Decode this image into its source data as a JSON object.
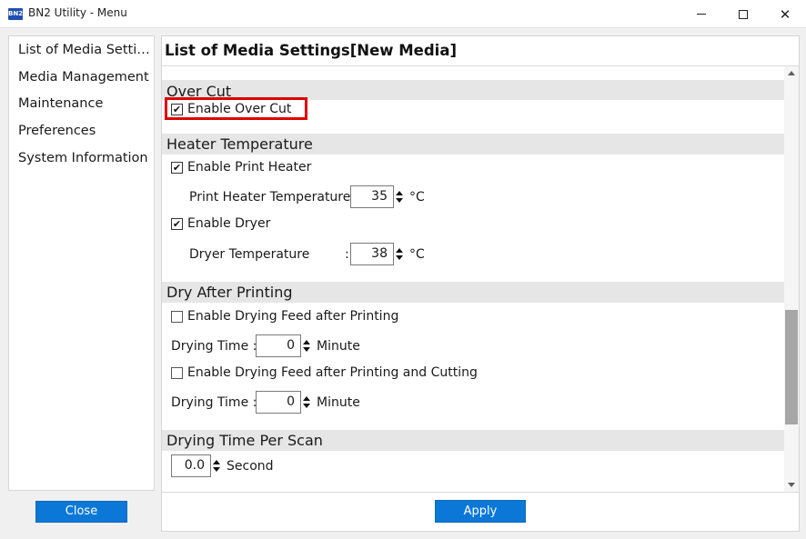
{
  "window": {
    "logo_text": "BN2",
    "title": "BN2 Utility - Menu"
  },
  "sidebar": {
    "items": [
      {
        "label": "List of Media Settings"
      },
      {
        "label": "Media Management"
      },
      {
        "label": "Maintenance"
      },
      {
        "label": "Preferences"
      },
      {
        "label": "System Information"
      }
    ],
    "close_label": "Close"
  },
  "main": {
    "title": "List of Media Settings[New Media]",
    "apply_label": "Apply",
    "sections": {
      "over_cut": {
        "header": "Over Cut",
        "enable_label": "Enable Over Cut",
        "enable_checked": true
      },
      "heater": {
        "header": "Heater Temperature",
        "print_heater_label": "Enable Print Heater",
        "print_heater_checked": true,
        "print_heater_temp_label": "Print Heater Temperature :",
        "print_heater_temp_value": "35",
        "unit": "°C",
        "dryer_label": "Enable Dryer",
        "dryer_checked": true,
        "dryer_temp_label": "Dryer Temperature",
        "dryer_colon": ":",
        "dryer_temp_value": "38"
      },
      "dry_after": {
        "header": "Dry After Printing",
        "feed_print_label": "Enable Drying Feed after Printing",
        "feed_print_checked": false,
        "drying_time_label": "Drying Time :",
        "drying_time_value_1": "0",
        "minute_unit": "Minute",
        "feed_cut_label": "Enable Drying Feed after Printing and Cutting",
        "feed_cut_checked": false,
        "drying_time_value_2": "0"
      },
      "per_scan": {
        "header": "Drying Time Per Scan",
        "value": "0.0",
        "unit": "Second"
      }
    }
  },
  "colors": {
    "accent": "#0b78d7",
    "highlight": "#e00000",
    "section_bg": "#e6e6e6"
  },
  "icons": {
    "check": "✔",
    "close": "✕"
  }
}
